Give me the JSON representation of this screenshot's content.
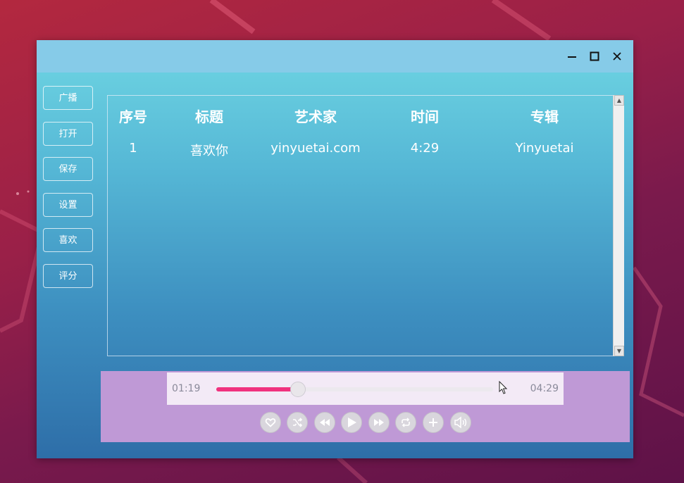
{
  "colors": {
    "desktop_top": "#b3283f",
    "desktop_bottom": "#5e1248",
    "titlebar": "#86cbe8",
    "player_bg": "#bf99d6",
    "progress_fill": "#f0327e"
  },
  "window": {
    "controls": {
      "minimize_icon": "minimize-icon",
      "maximize_icon": "maximize-icon",
      "close_icon": "close-icon"
    }
  },
  "sidebar": {
    "items": [
      {
        "label": "广播"
      },
      {
        "label": "打开"
      },
      {
        "label": "保存"
      },
      {
        "label": "设置"
      },
      {
        "label": "喜欢"
      },
      {
        "label": "评分"
      }
    ]
  },
  "table": {
    "headers": [
      "序号",
      "标题",
      "艺术家",
      "时间",
      "专辑"
    ],
    "rows": [
      {
        "index": "1",
        "title": "喜欢你",
        "artist": "yinyuetai.com",
        "duration": "4:29",
        "album": "Yinyuetai"
      }
    ]
  },
  "player": {
    "elapsed": "01:19",
    "total": "04:29",
    "progress_fraction": 0.294,
    "controls": [
      "heart-icon",
      "shuffle-icon",
      "rewind-icon",
      "play-icon",
      "fast-forward-icon",
      "repeat-icon",
      "add-icon",
      "volume-icon"
    ]
  }
}
